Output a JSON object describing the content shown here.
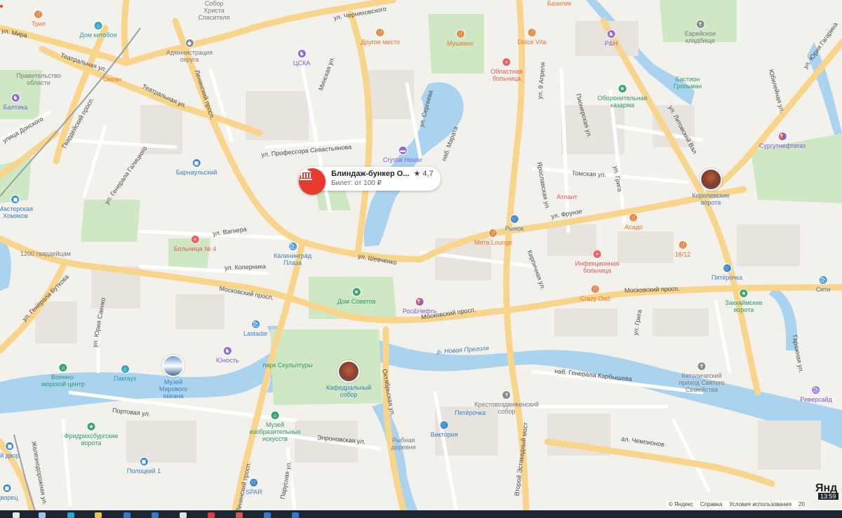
{
  "map": {
    "card": {
      "title": "Блиндаж-бункер О...",
      "rating": "★ 4,7",
      "subtitle": "Билет: от 100 ₽"
    },
    "streets": [
      {
        "text": "ул. Черняховского"
      },
      {
        "text": "Театральная ул."
      },
      {
        "text": "ул. Мира"
      },
      {
        "text": "Ленинский просп."
      },
      {
        "text": "Театральная ул."
      },
      {
        "text": "Гвардейский просп."
      },
      {
        "text": "ул. Генерала Галицкого"
      },
      {
        "text": "ул. Профессора Севастьянова"
      },
      {
        "text": "Минская ул."
      },
      {
        "text": "ул. Сергеева"
      },
      {
        "text": "наб. Марата"
      },
      {
        "text": "ул. 9 Апреля"
      },
      {
        "text": "ул. Литовский Вал"
      },
      {
        "text": "ул. Юрия Гагарина"
      },
      {
        "text": "Пионерская ул."
      },
      {
        "text": "ул. Вагнера"
      },
      {
        "text": "ул. Коперника"
      },
      {
        "text": "ул. Шевченко"
      },
      {
        "text": "ул. Фрунзе"
      },
      {
        "text": "Московский просп."
      },
      {
        "text": "Московский просп."
      },
      {
        "text": "Московский просп."
      },
      {
        "text": "ул. Генерала Буткова"
      },
      {
        "text": "ул. Юрия Саенко"
      },
      {
        "text": "Портовая ул."
      },
      {
        "text": "Октябрьская ул."
      },
      {
        "text": "Эпроновская ул."
      },
      {
        "text": "Железнодорожная ул."
      },
      {
        "text": "Ленинский просп."
      },
      {
        "text": "Парусная ул."
      },
      {
        "text": "р. Новая Преголя"
      },
      {
        "text": "наб. Генерала Карбышева"
      },
      {
        "text": "ал. Чемпионов"
      },
      {
        "text": "Второй Эстакадный мост"
      },
      {
        "text": "Томская ул."
      },
      {
        "text": "ул. Грига"
      },
      {
        "text": "Ярославская ул."
      },
      {
        "text": "Кирпичная ул."
      },
      {
        "text": "ул. Грига"
      },
      {
        "text": "Гаражная ул."
      },
      {
        "text": "Юбилейная ул."
      },
      {
        "text": "улица Донского"
      }
    ],
    "pois": [
      {
        "name": "Собор\nХриста\nСпасителя",
        "icon": "church-icon",
        "color": "#8a8a8a"
      },
      {
        "name": "Трип",
        "icon": "food-icon",
        "color": "#f0873a"
      },
      {
        "name": "Дом китобоя",
        "icon": "museum-icon",
        "color": "#34a8bf"
      },
      {
        "name": "Администрация\nокруга",
        "icon": "government-icon",
        "color": "#8a8a8a"
      },
      {
        "name": "ЦСКА",
        "icon": "sport-icon",
        "color": "#8d6bdc"
      },
      {
        "name": "Другое место",
        "icon": "food-icon",
        "color": "#f0873a"
      },
      {
        "name": "Мушкино",
        "icon": "food-icon",
        "color": "#f0873a"
      },
      {
        "name": "Dolce Vita",
        "icon": "food-icon",
        "color": "#f0873a"
      },
      {
        "name": "Базилик",
        "icon": "food-icon",
        "color": "#f0873a"
      },
      {
        "name": "P&H",
        "icon": "sport-icon",
        "color": "#8d6bdc"
      },
      {
        "name": "Еврейское\nкладбище",
        "icon": "cemetery-icon",
        "color": "#8a8a8a"
      },
      {
        "name": "Правительство\nобласти",
        "icon": "government-icon",
        "color": "#8a8a8a"
      },
      {
        "name": "Океан",
        "icon": "food-icon",
        "color": "#f0873a"
      },
      {
        "name": "Балтика",
        "icon": "sport-icon",
        "color": "#8d6bdc"
      },
      {
        "name": "Областная\nбольница",
        "icon": "hospital-icon",
        "color": "#ef6161"
      },
      {
        "name": "Бастион\nГрольман",
        "icon": "landmark-icon",
        "color": "#37a46f"
      },
      {
        "name": "Оборонительная\nказарма",
        "icon": "landmark-icon",
        "color": "#37a46f"
      },
      {
        "name": "Crystal House",
        "icon": "hotel-icon",
        "color": "#8d6bdc"
      },
      {
        "name": "Сургутнефтегаз",
        "icon": "fuel-icon",
        "color": "#8d6bdc"
      },
      {
        "name": "Барнаульский",
        "icon": "shop-icon",
        "color": "#3b8ad6"
      },
      {
        "name": "Королевские\nворота",
        "icon": "landmark-photo-icon",
        "color": "#3b8ad6"
      },
      {
        "name": "Мастерская\nХомяков",
        "icon": "shop-icon",
        "color": "#3b8ad6"
      },
      {
        "name": "Атлант",
        "icon": "fitness-icon",
        "color": "#ef6161"
      },
      {
        "name": "Асадо",
        "icon": "food-icon",
        "color": "#f0873a"
      },
      {
        "name": "Рынок",
        "icon": "market-icon",
        "color": "#3b8ad6"
      },
      {
        "name": "Мята Lounge",
        "icon": "food-icon",
        "color": "#f0873a"
      },
      {
        "name": "Больница № 4",
        "icon": "hospital-icon",
        "color": "#ef6161"
      },
      {
        "name": "Калининград\nПлаза",
        "icon": "mall-icon",
        "color": "#3b8ad6"
      },
      {
        "name": "1200 гвардейцам",
        "icon": "monument-icon",
        "color": "#8a8a8a"
      },
      {
        "name": "Инфекционная\nбольница",
        "icon": "hospital-icon",
        "color": "#ef6161"
      },
      {
        "name": "18/12",
        "icon": "food-icon",
        "color": "#f0873a"
      },
      {
        "name": "Пятёрочка",
        "icon": "grocery-icon",
        "color": "#3b8ad6"
      },
      {
        "name": "Сити",
        "icon": "mall-icon",
        "color": "#3b8ad6"
      },
      {
        "name": "Дом Советов",
        "icon": "landmark-icon",
        "color": "#37a46f"
      },
      {
        "name": "Рос&Нефть",
        "icon": "fuel-icon",
        "color": "#8d6bdc"
      },
      {
        "name": "Crazy Dad",
        "icon": "food-icon",
        "color": "#f0873a"
      },
      {
        "name": "Закхаймские\nворота",
        "icon": "landmark-icon",
        "color": "#37a46f"
      },
      {
        "name": "Lastadie",
        "icon": "mall-icon",
        "color": "#3b8ad6"
      },
      {
        "name": "Юность",
        "icon": "sport-icon",
        "color": "#8d6bdc"
      },
      {
        "name": "Военно-\nморской центр",
        "icon": "museum-icon",
        "color": "#37a46f"
      },
      {
        "name": "Пакгауз",
        "icon": "museum-icon",
        "color": "#34a8bf"
      },
      {
        "name": "Музей\nМирового\nокеана",
        "icon": "museum-photo-icon",
        "color": "#3b8ad6"
      },
      {
        "name": "парк Скульптуры",
        "icon": "park-icon",
        "color": "#37a46f"
      },
      {
        "name": "Кафедральный\nсобор",
        "icon": "cathedral-photo-icon",
        "color": "#3b8ad6"
      },
      {
        "name": "Католический\nприход Святого\nСемейства",
        "icon": "church-icon",
        "color": "#8a8a8a"
      },
      {
        "name": "Крестовоздвиженский\nсобор",
        "icon": "church-icon",
        "color": "#8a8a8a"
      },
      {
        "name": "Пятёрочка",
        "icon": "grocery-icon",
        "color": "#3b8ad6"
      },
      {
        "name": "Виктория",
        "icon": "grocery-icon",
        "color": "#3b8ad6"
      },
      {
        "name": "Фридрихсбургские\nворота",
        "icon": "landmark-icon",
        "color": "#37a46f"
      },
      {
        "name": "Музей\nизобразительных\nискусств",
        "icon": "museum-icon",
        "color": "#37a46f"
      },
      {
        "name": "Рыбная\nдеревня",
        "icon": "district-icon",
        "color": "#8a8a8a"
      },
      {
        "name": "Риверсайд",
        "icon": "mall-icon",
        "color": "#8d6bdc"
      },
      {
        "name": "Полоцкий 1",
        "icon": "shop-icon",
        "color": "#3b8ad6"
      },
      {
        "name": "SPAR",
        "icon": "grocery-icon",
        "color": "#3b8ad6"
      },
      {
        "name": "Дворец",
        "icon": "shop-icon",
        "color": "#3b8ad6"
      },
      {
        "name": "й двор",
        "icon": "shop-icon",
        "color": "#3b8ad6"
      }
    ],
    "attribution": {
      "copyright": "© Яндекс",
      "help": "Справка",
      "terms": "Условия использования",
      "scale": "20"
    },
    "logo": "Янд",
    "clock": "13:59"
  }
}
